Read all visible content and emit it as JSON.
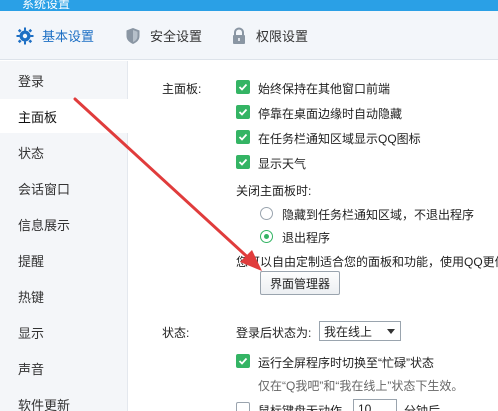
{
  "window": {
    "title": "系统设置"
  },
  "tabs": [
    {
      "label": "基本设置",
      "icon": "gear-icon"
    },
    {
      "label": "安全设置",
      "icon": "shield-icon"
    },
    {
      "label": "权限设置",
      "icon": "lock-icon"
    }
  ],
  "sidebar": {
    "items": [
      "登录",
      "主面板",
      "状态",
      "会话窗口",
      "信息展示",
      "提醒",
      "热键",
      "显示",
      "声音",
      "软件更新"
    ],
    "active": "主面板"
  },
  "main_panel": {
    "section_label": "主面板:",
    "options": [
      {
        "label": "始终保持在其他窗口前端",
        "checked": true
      },
      {
        "label": "停靠在桌面边缘时自动隐藏",
        "checked": true
      },
      {
        "label": "在任务栏通知区域显示QQ图标",
        "checked": true
      },
      {
        "label": "显示天气",
        "checked": true
      }
    ],
    "close_label": "关闭主面板时:",
    "close_options": [
      {
        "label": "隐藏到任务栏通知区域，不退出程序",
        "selected": false
      },
      {
        "label": "退出程序",
        "selected": true
      }
    ],
    "customize_text": "您可以自由定制适合您的面板和功能，使用QQ更便捷",
    "manager_button": "界面管理器"
  },
  "status": {
    "section_label": "状态:",
    "login_status_label": "登录后状态为:",
    "login_status_value": "我在线上",
    "fullscreen_option": {
      "label": "运行全屏程序时切换至“忙碌”状态",
      "checked": true
    },
    "fullscreen_note": "仅在“Q我吧”和“我在线上”状态下生效。",
    "idle_option_label": "鼠标键盘无动作",
    "idle_minutes": "10",
    "idle_suffix": "分钟后"
  },
  "colors": {
    "accent": "#2aa0e6",
    "check_green": "#34b464",
    "annotation_arrow": "#e03c3c"
  }
}
